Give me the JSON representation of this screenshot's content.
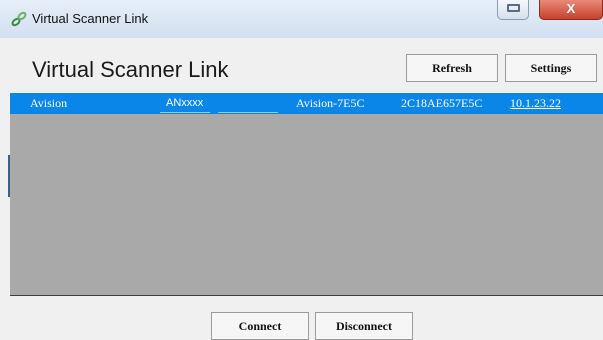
{
  "window": {
    "title": "Virtual Scanner Link",
    "close_label": "X"
  },
  "header": {
    "title": "Virtual Scanner Link",
    "refresh_label": "Refresh",
    "settings_label": "Settings"
  },
  "device_list": {
    "rows": [
      {
        "name": "Avision",
        "model": "ANxxxx",
        "host": "Avision-7E5C",
        "mac": "2C18AE657E5C",
        "ip": "10.1.23.22"
      }
    ]
  },
  "footer": {
    "connect_label": "Connect",
    "disconnect_label": "Disconnect"
  },
  "colors": {
    "selection": "#0a85e8",
    "list_bg": "#a9a9a9",
    "window_bg": "#f0f0f0"
  },
  "icons": {
    "app": "link-icon",
    "maximize": "restore-icon",
    "close": "close-icon"
  }
}
